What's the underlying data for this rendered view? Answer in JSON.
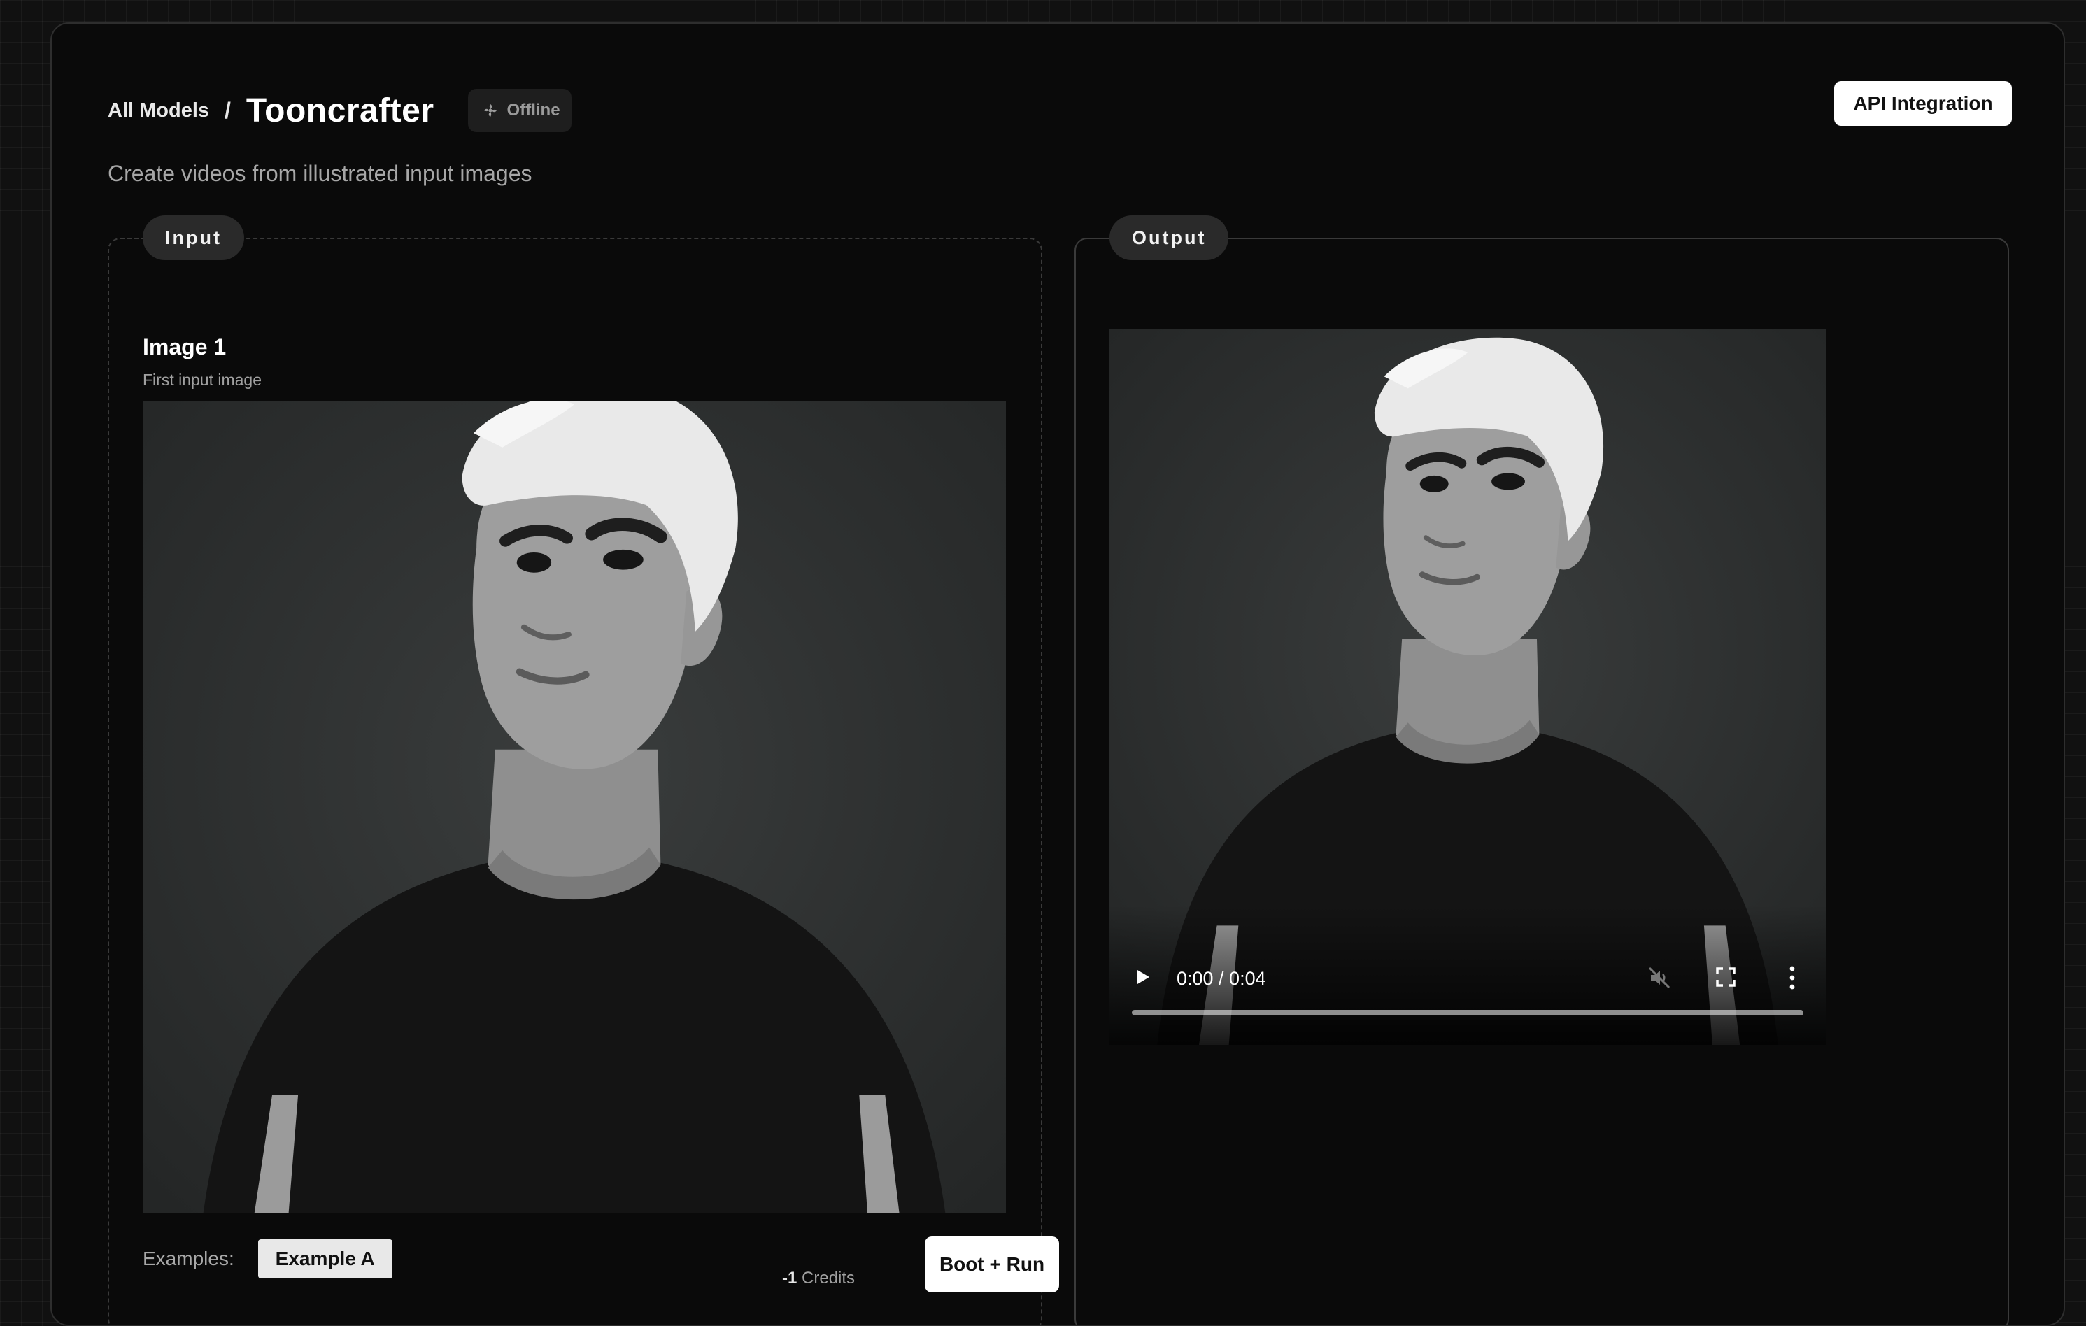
{
  "breadcrumb": {
    "parent": "All Models",
    "separator": "/",
    "title": "Tooncrafter"
  },
  "status": {
    "label": "Offline",
    "icon": "fan-icon"
  },
  "subtitle": "Create videos from illustrated input images",
  "api_button": "API Integration",
  "input_panel": {
    "title": "Input",
    "field": {
      "label": "Image 1",
      "description": "First input image"
    },
    "examples_label": "Examples:",
    "example_button": "Example A",
    "credits_value": "-1",
    "credits_label": "Credits",
    "run_button": "Boot + Run"
  },
  "output_panel": {
    "title": "Output",
    "video": {
      "time": "0:00 / 0:04",
      "progress": 0
    }
  },
  "colors": {
    "background": "#111111",
    "card": "#0a0a0a",
    "pill": "#2a2a2a",
    "image_bg": "#2e3030"
  }
}
